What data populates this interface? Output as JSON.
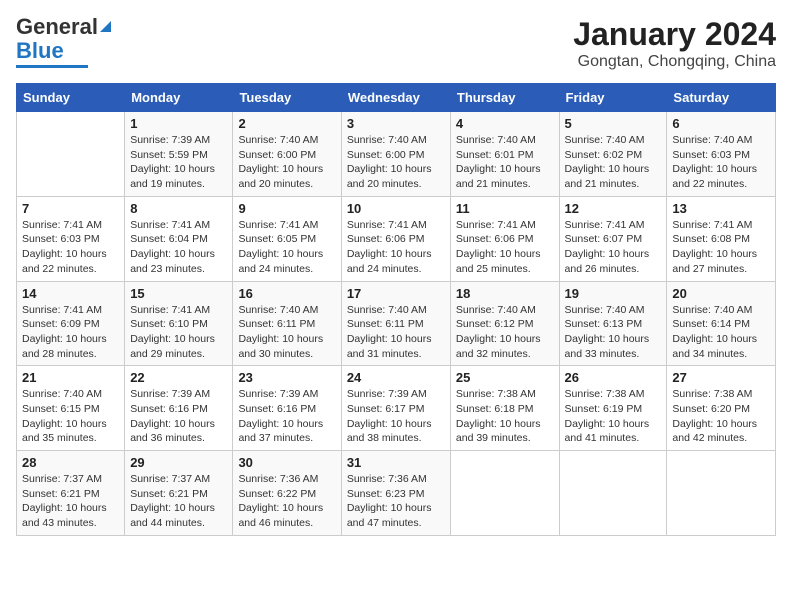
{
  "header": {
    "logo_line1": "General",
    "logo_line2": "Blue",
    "title": "January 2024",
    "subtitle": "Gongtan, Chongqing, China"
  },
  "calendar": {
    "weekdays": [
      "Sunday",
      "Monday",
      "Tuesday",
      "Wednesday",
      "Thursday",
      "Friday",
      "Saturday"
    ],
    "weeks": [
      [
        {
          "day": "",
          "info": ""
        },
        {
          "day": "1",
          "info": "Sunrise: 7:39 AM\nSunset: 5:59 PM\nDaylight: 10 hours\nand 19 minutes."
        },
        {
          "day": "2",
          "info": "Sunrise: 7:40 AM\nSunset: 6:00 PM\nDaylight: 10 hours\nand 20 minutes."
        },
        {
          "day": "3",
          "info": "Sunrise: 7:40 AM\nSunset: 6:00 PM\nDaylight: 10 hours\nand 20 minutes."
        },
        {
          "day": "4",
          "info": "Sunrise: 7:40 AM\nSunset: 6:01 PM\nDaylight: 10 hours\nand 21 minutes."
        },
        {
          "day": "5",
          "info": "Sunrise: 7:40 AM\nSunset: 6:02 PM\nDaylight: 10 hours\nand 21 minutes."
        },
        {
          "day": "6",
          "info": "Sunrise: 7:40 AM\nSunset: 6:03 PM\nDaylight: 10 hours\nand 22 minutes."
        }
      ],
      [
        {
          "day": "7",
          "info": "Sunrise: 7:41 AM\nSunset: 6:03 PM\nDaylight: 10 hours\nand 22 minutes."
        },
        {
          "day": "8",
          "info": "Sunrise: 7:41 AM\nSunset: 6:04 PM\nDaylight: 10 hours\nand 23 minutes."
        },
        {
          "day": "9",
          "info": "Sunrise: 7:41 AM\nSunset: 6:05 PM\nDaylight: 10 hours\nand 24 minutes."
        },
        {
          "day": "10",
          "info": "Sunrise: 7:41 AM\nSunset: 6:06 PM\nDaylight: 10 hours\nand 24 minutes."
        },
        {
          "day": "11",
          "info": "Sunrise: 7:41 AM\nSunset: 6:06 PM\nDaylight: 10 hours\nand 25 minutes."
        },
        {
          "day": "12",
          "info": "Sunrise: 7:41 AM\nSunset: 6:07 PM\nDaylight: 10 hours\nand 26 minutes."
        },
        {
          "day": "13",
          "info": "Sunrise: 7:41 AM\nSunset: 6:08 PM\nDaylight: 10 hours\nand 27 minutes."
        }
      ],
      [
        {
          "day": "14",
          "info": "Sunrise: 7:41 AM\nSunset: 6:09 PM\nDaylight: 10 hours\nand 28 minutes."
        },
        {
          "day": "15",
          "info": "Sunrise: 7:41 AM\nSunset: 6:10 PM\nDaylight: 10 hours\nand 29 minutes."
        },
        {
          "day": "16",
          "info": "Sunrise: 7:40 AM\nSunset: 6:11 PM\nDaylight: 10 hours\nand 30 minutes."
        },
        {
          "day": "17",
          "info": "Sunrise: 7:40 AM\nSunset: 6:11 PM\nDaylight: 10 hours\nand 31 minutes."
        },
        {
          "day": "18",
          "info": "Sunrise: 7:40 AM\nSunset: 6:12 PM\nDaylight: 10 hours\nand 32 minutes."
        },
        {
          "day": "19",
          "info": "Sunrise: 7:40 AM\nSunset: 6:13 PM\nDaylight: 10 hours\nand 33 minutes."
        },
        {
          "day": "20",
          "info": "Sunrise: 7:40 AM\nSunset: 6:14 PM\nDaylight: 10 hours\nand 34 minutes."
        }
      ],
      [
        {
          "day": "21",
          "info": "Sunrise: 7:40 AM\nSunset: 6:15 PM\nDaylight: 10 hours\nand 35 minutes."
        },
        {
          "day": "22",
          "info": "Sunrise: 7:39 AM\nSunset: 6:16 PM\nDaylight: 10 hours\nand 36 minutes."
        },
        {
          "day": "23",
          "info": "Sunrise: 7:39 AM\nSunset: 6:16 PM\nDaylight: 10 hours\nand 37 minutes."
        },
        {
          "day": "24",
          "info": "Sunrise: 7:39 AM\nSunset: 6:17 PM\nDaylight: 10 hours\nand 38 minutes."
        },
        {
          "day": "25",
          "info": "Sunrise: 7:38 AM\nSunset: 6:18 PM\nDaylight: 10 hours\nand 39 minutes."
        },
        {
          "day": "26",
          "info": "Sunrise: 7:38 AM\nSunset: 6:19 PM\nDaylight: 10 hours\nand 41 minutes."
        },
        {
          "day": "27",
          "info": "Sunrise: 7:38 AM\nSunset: 6:20 PM\nDaylight: 10 hours\nand 42 minutes."
        }
      ],
      [
        {
          "day": "28",
          "info": "Sunrise: 7:37 AM\nSunset: 6:21 PM\nDaylight: 10 hours\nand 43 minutes."
        },
        {
          "day": "29",
          "info": "Sunrise: 7:37 AM\nSunset: 6:21 PM\nDaylight: 10 hours\nand 44 minutes."
        },
        {
          "day": "30",
          "info": "Sunrise: 7:36 AM\nSunset: 6:22 PM\nDaylight: 10 hours\nand 46 minutes."
        },
        {
          "day": "31",
          "info": "Sunrise: 7:36 AM\nSunset: 6:23 PM\nDaylight: 10 hours\nand 47 minutes."
        },
        {
          "day": "",
          "info": ""
        },
        {
          "day": "",
          "info": ""
        },
        {
          "day": "",
          "info": ""
        }
      ]
    ]
  }
}
